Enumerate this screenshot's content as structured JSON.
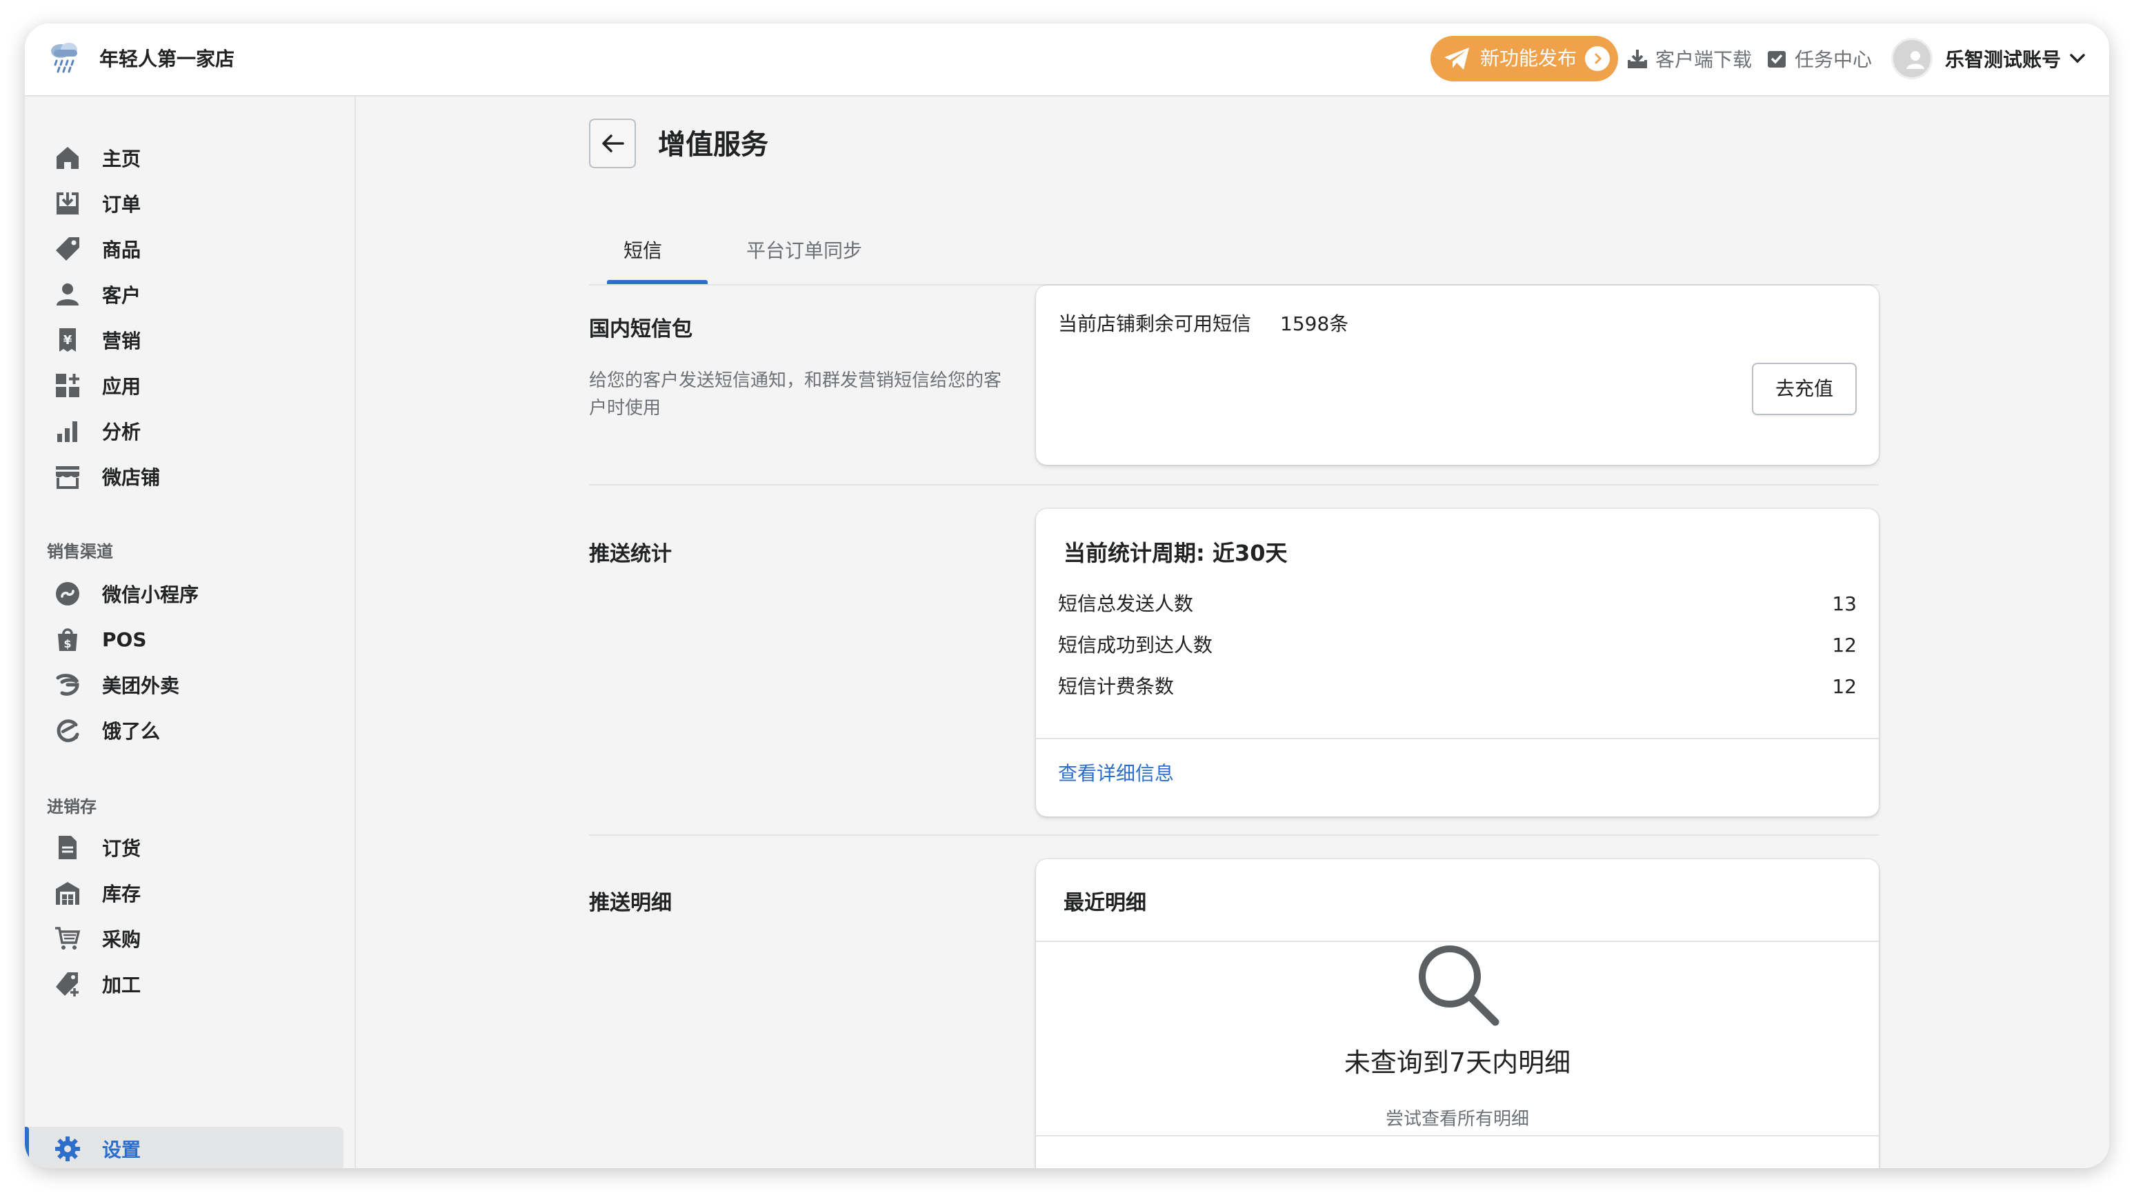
{
  "header": {
    "store_name": "年轻人第一家店",
    "new_feature_label": "新功能发布",
    "download_label": "客户端下载",
    "task_label": "任务中心",
    "account_name": "乐智测试账号"
  },
  "sidebar": {
    "main_items": [
      {
        "label": "主页",
        "icon": "home-icon"
      },
      {
        "label": "订单",
        "icon": "orders-icon"
      },
      {
        "label": "商品",
        "icon": "tag-icon"
      },
      {
        "label": "客户",
        "icon": "customer-icon"
      },
      {
        "label": "营销",
        "icon": "marketing-icon"
      },
      {
        "label": "应用",
        "icon": "apps-icon"
      },
      {
        "label": "分析",
        "icon": "analytics-icon"
      },
      {
        "label": "微店铺",
        "icon": "store-icon"
      }
    ],
    "sales_title": "销售渠道",
    "sales_items": [
      {
        "label": "微信小程序",
        "icon": "miniprogram-icon"
      },
      {
        "label": "POS",
        "icon": "pos-icon"
      },
      {
        "label": "美团外卖",
        "icon": "meituan-icon"
      },
      {
        "label": "饿了么",
        "icon": "eleme-icon"
      }
    ],
    "inventory_title": "进销存",
    "inventory_items": [
      {
        "label": "订货",
        "icon": "document-icon"
      },
      {
        "label": "库存",
        "icon": "warehouse-icon"
      },
      {
        "label": "采购",
        "icon": "cart-icon"
      },
      {
        "label": "加工",
        "icon": "tag-add-icon"
      }
    ],
    "settings_label": "设置"
  },
  "page": {
    "title": "增值服务",
    "tabs": [
      "短信",
      "平台订单同步"
    ]
  },
  "sms_package": {
    "title": "国内短信包",
    "description": "给您的客户发送短信通知，和群发营销短信给您的客户时使用",
    "remaining_label": "当前店铺剩余可用短信",
    "remaining_value": "1598条",
    "recharge_label": "去充值"
  },
  "push_stats": {
    "title": "推送统计",
    "period_label": "当前统计周期: 近30天",
    "rows": [
      {
        "label": "短信总发送人数",
        "value": "13"
      },
      {
        "label": "短信成功到达人数",
        "value": "12"
      },
      {
        "label": "短信计费条数",
        "value": "12"
      }
    ],
    "detail_link": "查看详细信息"
  },
  "push_details": {
    "title": "推送明细",
    "card_title": "最近明细",
    "empty_title": "未查询到7天内明细",
    "empty_subtitle": "尝试查看所有明细"
  }
}
